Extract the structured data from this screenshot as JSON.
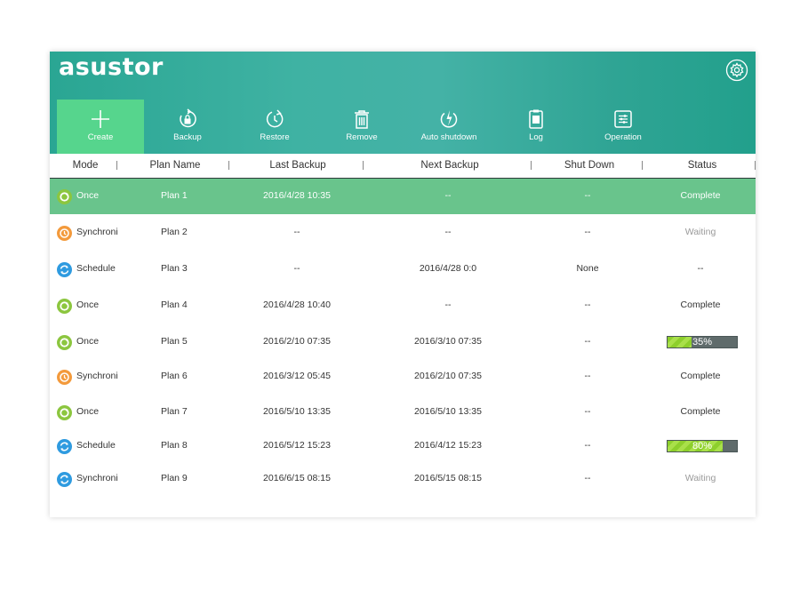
{
  "app": {
    "logo": "asustor"
  },
  "colors": {
    "accent": "#2aa693",
    "active": "#56d58d",
    "selected_row": "#69c48c",
    "once": "#8cc63f",
    "synchroni": "#f39a3c",
    "schedule": "#2f9be0",
    "progress": "#8dcf2c"
  },
  "toolbar": [
    {
      "label": "Create",
      "icon": "plus-icon"
    },
    {
      "label": "Backup",
      "icon": "backup-lock-icon"
    },
    {
      "label": "Restore",
      "icon": "restore-icon"
    },
    {
      "label": "Remove",
      "icon": "trash-icon"
    },
    {
      "label": "Auto shutdown",
      "icon": "power-icon"
    },
    {
      "label": "Log",
      "icon": "log-icon"
    },
    {
      "label": "Operation",
      "icon": "operation-icon"
    }
  ],
  "columns": [
    "Mode",
    "Plan Name",
    "Last Backup",
    "Next Backup",
    "Shut Down",
    "Status"
  ],
  "rows": [
    {
      "mode": "Once",
      "mode_icon": "once-icon",
      "plan": "Plan 1",
      "last": "2016/4/28 10:35",
      "next": "--",
      "shutdown": "--",
      "status": "Complete",
      "status_type": "text",
      "selected": true
    },
    {
      "mode": "Synchroni",
      "mode_icon": "synchroni-icon",
      "plan": "Plan 2",
      "last": "--",
      "next": "--",
      "shutdown": "--",
      "status": "Waiting",
      "status_type": "waiting"
    },
    {
      "mode": "Schedule",
      "mode_icon": "schedule-icon",
      "plan": "Plan 3",
      "last": "--",
      "next": "2016/4/28 0:0",
      "shutdown": "None",
      "status": "--",
      "status_type": "text"
    },
    {
      "mode": "Once",
      "mode_icon": "once-icon",
      "plan": "Plan 4",
      "last": "2016/4/28 10:40",
      "next": "--",
      "shutdown": "--",
      "status": "Complete",
      "status_type": "text"
    },
    {
      "mode": "Once",
      "mode_icon": "once-icon",
      "plan": "Plan 5",
      "last": "2016/2/10 07:35",
      "next": "2016/3/10 07:35",
      "shutdown": "--",
      "status": "35%",
      "status_type": "progress",
      "progress": 35
    },
    {
      "mode": "Synchroni",
      "mode_icon": "synchroni-icon",
      "plan": "Plan 6",
      "last": "2016/3/12  05:45",
      "next": "2016/2/10 07:35",
      "shutdown": "--",
      "status": "Complete",
      "status_type": "text"
    },
    {
      "mode": "Once",
      "mode_icon": "once-icon",
      "plan": "Plan 7",
      "last": "2016/5/10 13:35",
      "next": "2016/5/10 13:35",
      "shutdown": "--",
      "status": "Complete",
      "status_type": "text"
    },
    {
      "mode": "Schedule",
      "mode_icon": "schedule-icon",
      "plan": "Plan 8",
      "last": "2016/5/12 15:23",
      "next": "2016/4/12 15:23",
      "shutdown": "--",
      "status": "80%",
      "status_type": "progress",
      "progress": 80
    },
    {
      "mode": "Synchroni",
      "mode_icon": "schedule-icon",
      "plan": "Plan 9",
      "last": "2016/6/15  08:15",
      "next": "2016/5/15 08:15",
      "shutdown": "--",
      "status": "Waiting",
      "status_type": "waiting"
    }
  ]
}
